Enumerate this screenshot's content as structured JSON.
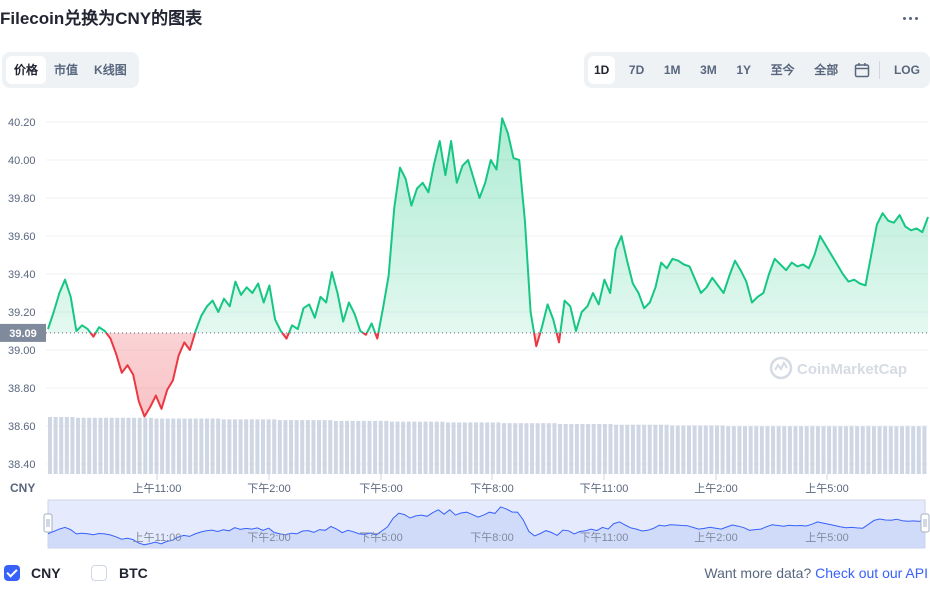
{
  "header": {
    "title": "Filecoin兑换为CNY的图表",
    "more_icon": "more-horizontal-icon"
  },
  "view_tabs": [
    {
      "label": "价格",
      "active": true
    },
    {
      "label": "市值",
      "active": false
    },
    {
      "label": "K线图",
      "active": false
    }
  ],
  "range_tabs": [
    {
      "label": "1D",
      "active": true
    },
    {
      "label": "7D",
      "active": false
    },
    {
      "label": "1M",
      "active": false
    },
    {
      "label": "3M",
      "active": false
    },
    {
      "label": "1Y",
      "active": false
    },
    {
      "label": "至今",
      "active": false
    },
    {
      "label": "全部",
      "active": false
    }
  ],
  "calendar_icon": "calendar-icon",
  "log_label": "LOG",
  "watermark": "CoinMarketCap",
  "colors": {
    "up": "#16c784",
    "down": "#ea3943",
    "volume": "#cfd6e4",
    "nav": "#3861fb"
  },
  "chart_data": {
    "type": "line",
    "x_labels": [
      "上午11:00",
      "下午2:00",
      "下午5:00",
      "下午8:00",
      "下午11:00",
      "上午2:00",
      "上午5:00"
    ],
    "ylabel": "CNY",
    "y_ticks": [
      "40.20",
      "40.00",
      "39.80",
      "39.60",
      "39.40",
      "39.20",
      "39.00",
      "38.80",
      "38.60",
      "38.40"
    ],
    "ylim": [
      38.4,
      40.3
    ],
    "reference_value": 39.09,
    "reference_label": "39.09",
    "grid": true,
    "series": [
      {
        "values": [
          39.11,
          39.2,
          39.3,
          39.37,
          39.28,
          39.1,
          39.13,
          39.11,
          39.07,
          39.12,
          39.1,
          39.06,
          38.98,
          38.88,
          38.92,
          38.87,
          38.73,
          38.65,
          38.7,
          38.76,
          38.69,
          38.79,
          38.84,
          38.97,
          39.04,
          39.0,
          39.1,
          39.18,
          39.23,
          39.26,
          39.2,
          39.27,
          39.23,
          39.36,
          39.29,
          39.33,
          39.3,
          39.35,
          39.25,
          39.34,
          39.16,
          39.1,
          39.06,
          39.13,
          39.11,
          39.22,
          39.24,
          39.17,
          39.28,
          39.25,
          39.41,
          39.3,
          39.15,
          39.25,
          39.19,
          39.1,
          39.08,
          39.14,
          39.06,
          39.22,
          39.39,
          39.75,
          39.96,
          39.9,
          39.76,
          39.85,
          39.88,
          39.83,
          39.98,
          40.1,
          39.92,
          40.1,
          39.88,
          39.97,
          40.0,
          39.9,
          39.8,
          39.88,
          40.0,
          39.95,
          40.22,
          40.14,
          40.01,
          40.0,
          39.68,
          39.2,
          39.02,
          39.12,
          39.24,
          39.16,
          39.04,
          39.26,
          39.23,
          39.1,
          39.2,
          39.23,
          39.3,
          39.24,
          39.37,
          39.3,
          39.53,
          39.6,
          39.47,
          39.35,
          39.3,
          39.22,
          39.25,
          39.33,
          39.46,
          39.43,
          39.48,
          39.47,
          39.45,
          39.44,
          39.37,
          39.3,
          39.33,
          39.38,
          39.34,
          39.3,
          39.39,
          39.47,
          39.42,
          39.36,
          39.25,
          39.28,
          39.3,
          39.4,
          39.48,
          39.45,
          39.42,
          39.46,
          39.44,
          39.45,
          39.43,
          39.5,
          39.6,
          39.55,
          39.5,
          39.45,
          39.4,
          39.36,
          39.37,
          39.35,
          39.34,
          39.5,
          39.66,
          39.72,
          39.68,
          39.67,
          39.71,
          39.65,
          39.63,
          39.64,
          39.62,
          39.7
        ]
      }
    ],
    "volume": [
      0.74,
      0.74,
      0.74,
      0.74,
      0.74,
      0.73,
      0.73,
      0.73,
      0.73,
      0.73,
      0.73,
      0.73,
      0.73,
      0.73,
      0.73,
      0.73,
      0.73,
      0.73,
      0.73,
      0.72,
      0.72,
      0.72,
      0.72,
      0.72,
      0.72,
      0.72,
      0.72,
      0.72,
      0.72,
      0.72,
      0.72,
      0.71,
      0.71,
      0.71,
      0.71,
      0.71,
      0.71,
      0.71,
      0.71,
      0.71,
      0.71,
      0.7,
      0.7,
      0.7,
      0.7,
      0.7,
      0.7,
      0.7,
      0.7,
      0.7,
      0.7,
      0.69,
      0.69,
      0.69,
      0.69,
      0.69,
      0.69,
      0.69,
      0.69,
      0.69,
      0.69,
      0.68,
      0.68,
      0.68,
      0.68,
      0.68,
      0.68,
      0.68,
      0.68,
      0.68,
      0.68,
      0.67,
      0.67,
      0.67,
      0.67,
      0.67,
      0.67,
      0.67,
      0.67,
      0.67,
      0.67,
      0.66,
      0.66,
      0.66,
      0.66,
      0.66,
      0.66,
      0.66,
      0.66,
      0.66,
      0.66,
      0.65,
      0.65,
      0.65,
      0.65,
      0.65,
      0.65,
      0.65,
      0.65,
      0.65,
      0.65,
      0.64,
      0.64,
      0.64,
      0.64,
      0.64,
      0.64,
      0.64,
      0.64,
      0.64,
      0.64,
      0.63,
      0.63,
      0.63,
      0.63,
      0.63,
      0.63,
      0.63,
      0.63,
      0.63,
      0.63,
      0.62,
      0.62,
      0.62,
      0.62,
      0.62,
      0.62,
      0.62,
      0.62,
      0.62,
      0.62,
      0.62,
      0.62,
      0.62,
      0.62,
      0.62,
      0.62,
      0.62,
      0.62,
      0.62,
      0.62,
      0.62,
      0.62,
      0.62,
      0.62,
      0.62,
      0.62,
      0.62,
      0.62,
      0.62,
      0.62,
      0.62,
      0.62,
      0.62,
      0.62,
      0.62,
      0.62
    ]
  },
  "legend": [
    {
      "label": "CNY",
      "checked": true
    },
    {
      "label": "BTC",
      "checked": false
    }
  ],
  "promo": {
    "text": "Want more data?",
    "link": "Check out our API"
  }
}
